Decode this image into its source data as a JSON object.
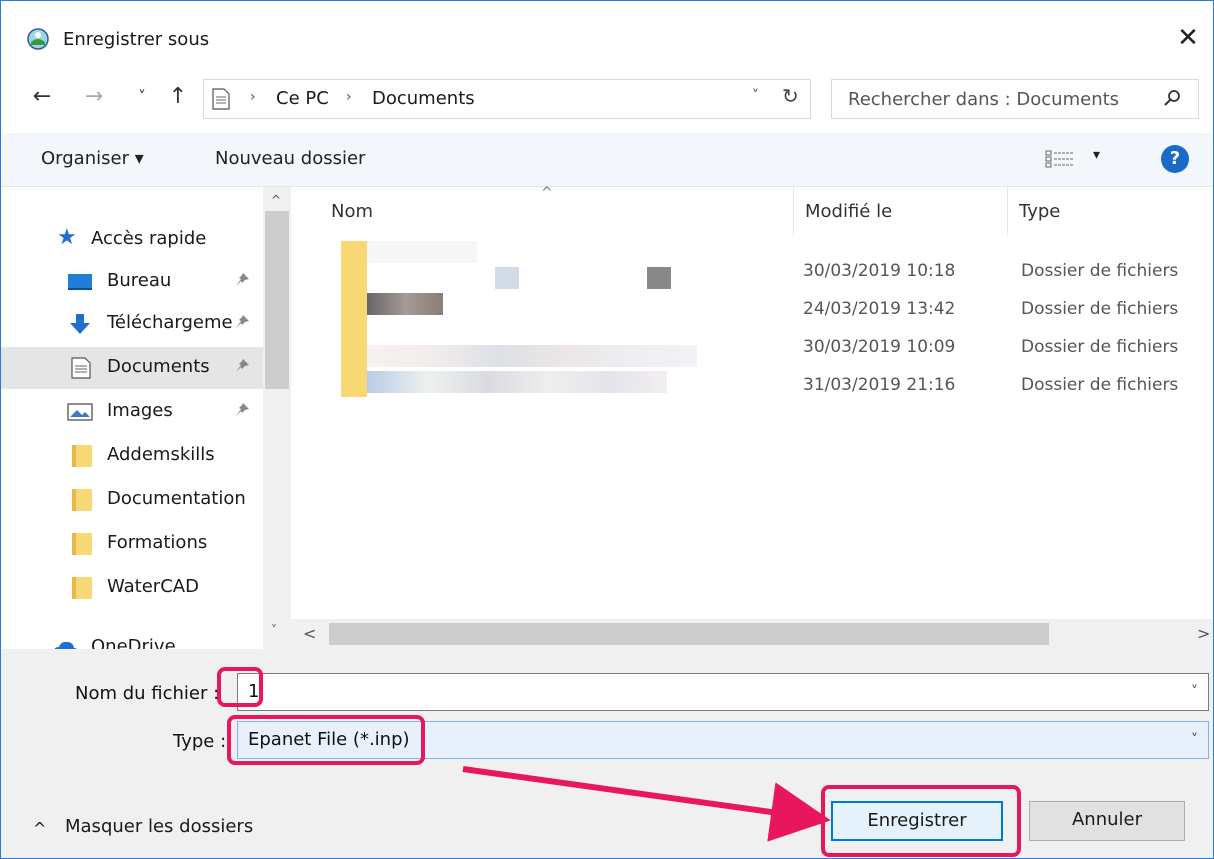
{
  "window": {
    "title": "Enregistrer sous"
  },
  "address": {
    "crumbs": [
      "Ce PC",
      "Documents"
    ],
    "separator": "›",
    "search_placeholder": "Rechercher dans : Documents"
  },
  "icons": {
    "back": "←",
    "forward": "→",
    "recent": "˅",
    "up": "↑",
    "refresh": "↻",
    "dropdown": "˅",
    "close": "✕",
    "help": "?",
    "sort": "^",
    "scroll_up": "^",
    "scroll_down": "˅",
    "scroll_left": "<",
    "scroll_right": ">",
    "hide_chevron": "^"
  },
  "toolbar": {
    "organize_label": "Organiser ▾",
    "new_folder_label": "Nouveau dossier"
  },
  "sidebar": {
    "items": [
      {
        "label": "Accès rapide",
        "icon": "star-icon"
      },
      {
        "label": "Bureau",
        "icon": "desktop-icon",
        "pinned": true
      },
      {
        "label": "Téléchargeme",
        "icon": "download-icon",
        "pinned": true
      },
      {
        "label": "Documents",
        "icon": "document-icon",
        "pinned": true,
        "selected": true
      },
      {
        "label": "Images",
        "icon": "image-icon",
        "pinned": true
      },
      {
        "label": "Addemskills",
        "icon": "folder-icon"
      },
      {
        "label": "Documentation",
        "icon": "folder-icon"
      },
      {
        "label": "Formations",
        "icon": "folder-icon"
      },
      {
        "label": "WaterCAD",
        "icon": "folder-icon"
      },
      {
        "label": "OneDrive",
        "icon": "cloud-icon"
      }
    ]
  },
  "filelist": {
    "columns": {
      "name": "Nom",
      "modified": "Modifié le",
      "type": "Type"
    },
    "rows": [
      {
        "modified": "30/03/2019 10:18",
        "type": "Dossier de fichiers"
      },
      {
        "modified": "24/03/2019 13:42",
        "type": "Dossier de fichiers"
      },
      {
        "modified": "30/03/2019 10:09",
        "type": "Dossier de fichiers"
      },
      {
        "modified": "31/03/2019 21:16",
        "type": "Dossier de fichiers"
      }
    ]
  },
  "form": {
    "filename_label": "Nom du fichier :",
    "filename_value": "1",
    "type_label": "Type :",
    "type_value": "Epanet File (*.inp)"
  },
  "footer": {
    "hide_folders_label": "Masquer les dossiers",
    "save_label": "Enregistrer",
    "cancel_label": "Annuler"
  },
  "colors": {
    "highlight": "#e8175d",
    "accent": "#0078d7",
    "folder": "#f8d775"
  }
}
